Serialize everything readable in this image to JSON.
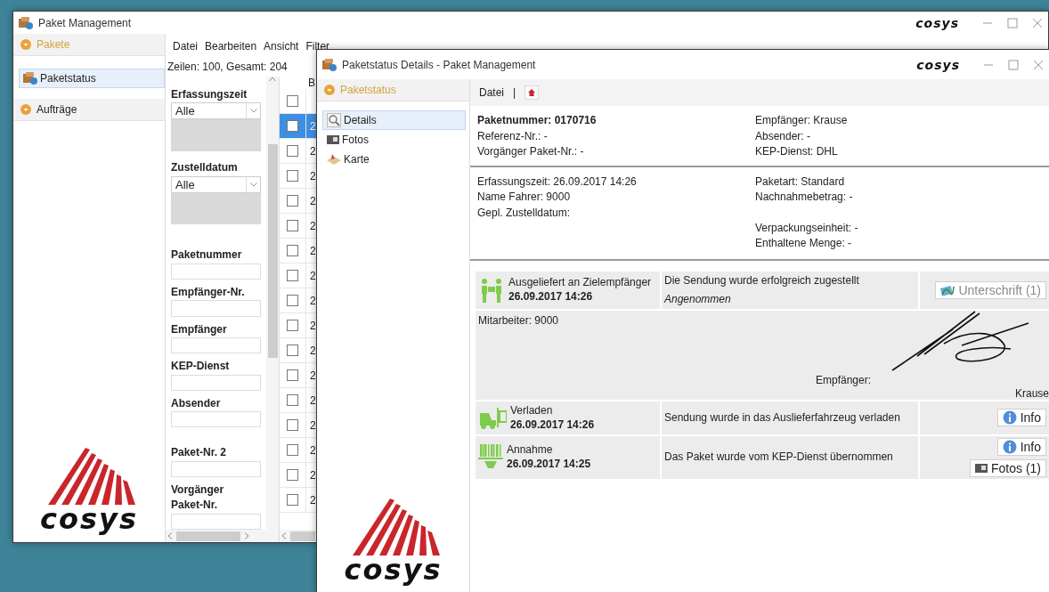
{
  "main_window": {
    "title": "Paket Management",
    "brand": "cosys",
    "sidebar": [
      {
        "label": "Pakete",
        "expanded": true,
        "children": [
          {
            "label": "Paketstatus",
            "selected": true
          }
        ]
      },
      {
        "label": "Aufträge",
        "expanded": false
      }
    ],
    "logo_text": "cosys",
    "menu": [
      "Datei",
      "Bearbeiten",
      "Ansicht",
      "Filter"
    ],
    "row_count": "Zeilen: 100, Gesamt: 204",
    "filters": [
      {
        "kind": "select",
        "label": "Erfassungszeit",
        "value": "Alle"
      },
      {
        "kind": "select",
        "label": "Zustelldatum",
        "value": "Alle"
      },
      {
        "kind": "text",
        "label": "Paketnummer"
      },
      {
        "kind": "text",
        "label": "Empfänger-Nr."
      },
      {
        "kind": "text",
        "label": "Empfänger"
      },
      {
        "kind": "text",
        "label": "KEP-Dienst"
      },
      {
        "kind": "text",
        "label": "Absender"
      },
      {
        "kind": "text",
        "label": "Paket-Nr. 2"
      },
      {
        "kind": "text",
        "label": "Vorgänger Paket-Nr."
      }
    ],
    "grid": {
      "column_header": "B",
      "select_all_checked": false,
      "rows": [
        {
          "cell": "2",
          "selected": true
        },
        {
          "cell": "2",
          "selected": false
        },
        {
          "cell": "2",
          "selected": false
        },
        {
          "cell": "2",
          "selected": false
        },
        {
          "cell": "2",
          "selected": false
        },
        {
          "cell": "2",
          "selected": false
        },
        {
          "cell": "2",
          "selected": false
        },
        {
          "cell": "2",
          "selected": false
        },
        {
          "cell": "2",
          "selected": false
        },
        {
          "cell": "2",
          "selected": false
        },
        {
          "cell": "2",
          "selected": false
        },
        {
          "cell": "2",
          "selected": false
        },
        {
          "cell": "2",
          "selected": false
        },
        {
          "cell": "2",
          "selected": false
        },
        {
          "cell": "2",
          "selected": false
        },
        {
          "cell": "2",
          "selected": false
        }
      ]
    }
  },
  "details_window": {
    "title": "Paketstatus Details - Paket Management",
    "brand": "cosys",
    "nav_header": "Paketstatus",
    "nav_items": [
      {
        "kind": "details",
        "label": "Details",
        "selected": true
      },
      {
        "kind": "photos",
        "label": "Fotos",
        "selected": false
      },
      {
        "kind": "map",
        "label": "Karte",
        "selected": false
      }
    ],
    "logo_text": "cosys",
    "toolbar": {
      "menu": "Datei",
      "separator": "|"
    },
    "summary": {
      "package_number": "Paketnummer: 0170716",
      "left": [
        "Referenz-Nr.: -",
        "Vorgänger Paket-Nr.: -"
      ],
      "right": [
        [
          "Empfänger: Krause",
          "Absender: -",
          "KEP-Dienst: DHL"
        ]
      ]
    },
    "details": {
      "left": [
        "Erfassungszeit: 26.09.2017 14:26",
        "Name Fahrer: 9000",
        "Gepl. Zustelldatum:"
      ],
      "right": [
        [
          "Paketart: Standard",
          "Nachnahmebetrag: -"
        ],
        [
          "Verpackungseinheit: -",
          "Enthaltene Menge: -"
        ]
      ]
    },
    "events": [
      {
        "kind": "delivered",
        "status": "Ausgeliefert an Zielempfänger",
        "time": "26.09.2017 14:26",
        "message": "Die Sendung wurde erfolgreich zugestellt",
        "note": "Angenommen",
        "buttons": [
          {
            "kind": "signature",
            "label": "Unterschrift (1)",
            "disabled": true
          }
        ],
        "detail": {
          "employee": "Mitarbeiter: 9000",
          "recipient_label": "Empfänger:",
          "recipient": "Krause"
        }
      },
      {
        "kind": "loaded",
        "status": "Verladen",
        "time": "26.09.2017 14:26",
        "message": "Sendung wurde in das Auslieferfahrzeug verladen",
        "buttons": [
          {
            "kind": "info",
            "label": "Info",
            "disabled": false
          }
        ]
      },
      {
        "kind": "accepted",
        "status": "Annahme",
        "time": "26.09.2017 14:25",
        "message": "Das Paket wurde vom KEP-Dienst übernommen",
        "buttons": [
          {
            "kind": "info",
            "label": "Info",
            "disabled": false
          },
          {
            "kind": "photos",
            "label": "Fotos (1)",
            "disabled": false
          }
        ]
      }
    ]
  }
}
